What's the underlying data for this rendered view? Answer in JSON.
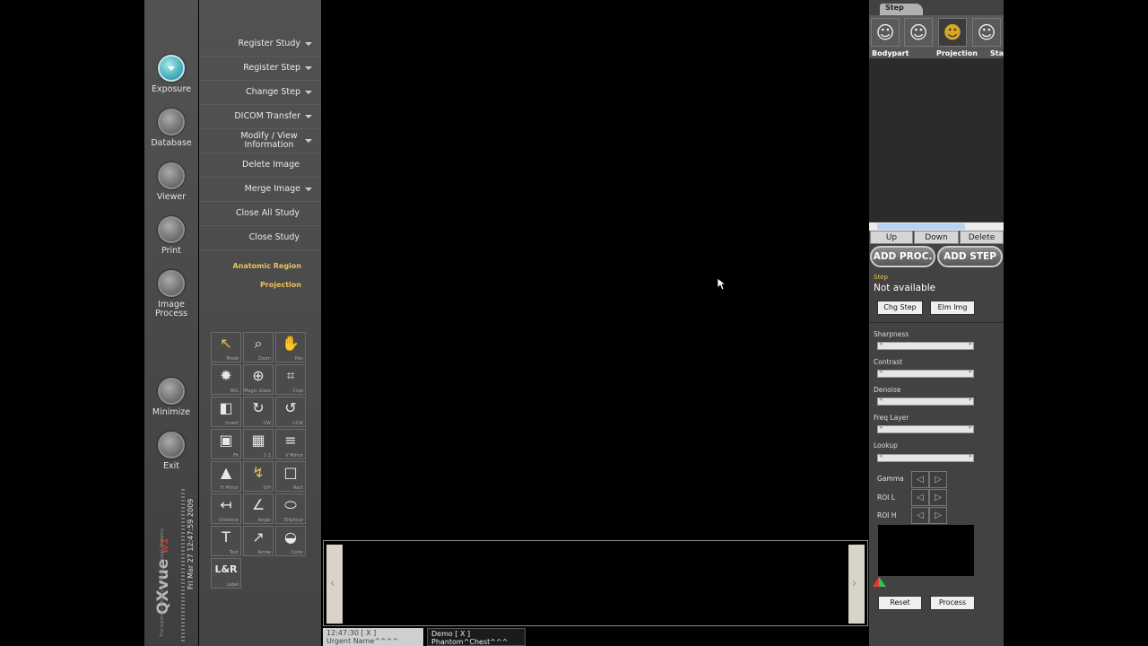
{
  "nav": {
    "items": [
      {
        "label": "Exposure",
        "active": true
      },
      {
        "label": "Database"
      },
      {
        "label": "Viewer"
      },
      {
        "label": "Print"
      },
      {
        "label": "Image\nProcess"
      },
      {
        "label": "Minimize"
      },
      {
        "label": "Exit"
      }
    ]
  },
  "logo": {
    "brand": "QXvue",
    "version": "w1",
    "tagline": "The leading company of Medical Image Modality",
    "datetime": "Fri Mar 27 12:47:59 2009"
  },
  "menu": {
    "items": [
      {
        "label": "Register Study",
        "arrow": true
      },
      {
        "label": "Register Step",
        "arrow": true
      },
      {
        "label": "Change Step",
        "arrow": true
      },
      {
        "label": "DICOM Transfer",
        "arrow": true
      },
      {
        "label": "Modify / View Information",
        "arrow": true
      },
      {
        "label": "Delete Image",
        "arrow": false
      },
      {
        "label": "Merge Image",
        "arrow": true
      },
      {
        "label": "Close All Study",
        "arrow": false
      },
      {
        "label": "Close Study",
        "arrow": false
      }
    ],
    "anatomic_region": "Anatomic Region",
    "projection": "Projection"
  },
  "tools": [
    {
      "name": "mode",
      "label": "Mode",
      "icon": "arrow-pointer-icon"
    },
    {
      "name": "zoom",
      "label": "Zoom",
      "icon": "magnifier-icon"
    },
    {
      "name": "pan",
      "label": "Pan",
      "icon": "hand-icon"
    },
    {
      "name": "wl",
      "label": "W/L",
      "icon": "sun-icon"
    },
    {
      "name": "magic-glass",
      "label": "Magic Glass",
      "icon": "magic-glass-icon"
    },
    {
      "name": "crop",
      "label": "Crop",
      "icon": "crop-icon"
    },
    {
      "name": "invert",
      "label": "Invert",
      "icon": "invert-icon"
    },
    {
      "name": "cw",
      "label": "CW",
      "icon": "rotate-cw-icon"
    },
    {
      "name": "ccw",
      "label": "CCW",
      "icon": "rotate-ccw-icon"
    },
    {
      "name": "fit",
      "label": "Fit",
      "icon": "fit-icon"
    },
    {
      "name": "one-to-one",
      "label": "1:1",
      "icon": "actual-size-icon"
    },
    {
      "name": "v-mirror",
      "label": "V Mirror",
      "icon": "v-mirror-icon"
    },
    {
      "name": "h-mirror",
      "label": "H Mirror",
      "icon": "h-mirror-icon"
    },
    {
      "name": "sh",
      "label": "S/H",
      "icon": "show-hide-icon"
    },
    {
      "name": "rect",
      "label": "Rect",
      "icon": "rectangle-icon"
    },
    {
      "name": "distance",
      "label": "Distance",
      "icon": "distance-icon"
    },
    {
      "name": "angle",
      "label": "Angle",
      "icon": "angle-icon"
    },
    {
      "name": "elliptical",
      "label": "Elliptical",
      "icon": "ellipse-icon"
    },
    {
      "name": "text",
      "label": "Text",
      "icon": "text-icon"
    },
    {
      "name": "arrow",
      "label": "Arrow",
      "icon": "arrow-icon"
    },
    {
      "name": "color",
      "label": "Color",
      "icon": "palette-icon"
    },
    {
      "name": "label",
      "label": "Label",
      "icon": "lr-label-icon",
      "text": "L&R"
    }
  ],
  "tool_glyphs": {
    "mode": "↖",
    "zoom": "⌕",
    "pan": "✋",
    "wl": "✹",
    "magic-glass": "⊕",
    "crop": "⌗",
    "invert": "◧",
    "cw": "↻",
    "ccw": "↺",
    "fit": "▣",
    "one-to-one": "▦",
    "v-mirror": "≡",
    "h-mirror": "▲",
    "sh": "↯",
    "rect": "□",
    "distance": "↤",
    "angle": "∠",
    "elliptical": "⬭",
    "text": "T",
    "arrow": "↗",
    "color": "◒",
    "label": "L&R"
  },
  "thumbnails": {
    "prev": "‹",
    "next": "›",
    "tabs": [
      {
        "line1": "12:47:30 [ X ]",
        "line2": "Urgent Name^^^^"
      },
      {
        "line1": "Demo [ X ]",
        "line2": "Phantom^Chest^^^"
      }
    ]
  },
  "right_panel": {
    "tab_label": "Step",
    "step_icons": [
      "person-icon",
      "person-icon",
      "person-selected-icon",
      "person-icon"
    ],
    "columns": [
      "Bodypart",
      "Projection",
      "Sta"
    ],
    "buttons": {
      "up": "Up",
      "down": "Down",
      "delete": "Delete"
    },
    "add_proc": "ADD PROC.",
    "add_step": "ADD STEP",
    "step_label": "Step",
    "step_value": "Not available",
    "chg_step": "Chg Step",
    "elm_img": "Elm Img",
    "sliders": [
      "Sharpness",
      "Contrast",
      "Denoise",
      "Freq Layer",
      "Lookup"
    ],
    "adjusters": [
      "Gamma",
      "ROI L",
      "ROI H"
    ],
    "reset": "Reset",
    "process": "Process"
  },
  "colors": {
    "accent_cyan": "#3aa5b4",
    "menu_highlight": "#e7c25a",
    "version_red": "#c0392b",
    "selected_person": "#d9a623"
  }
}
